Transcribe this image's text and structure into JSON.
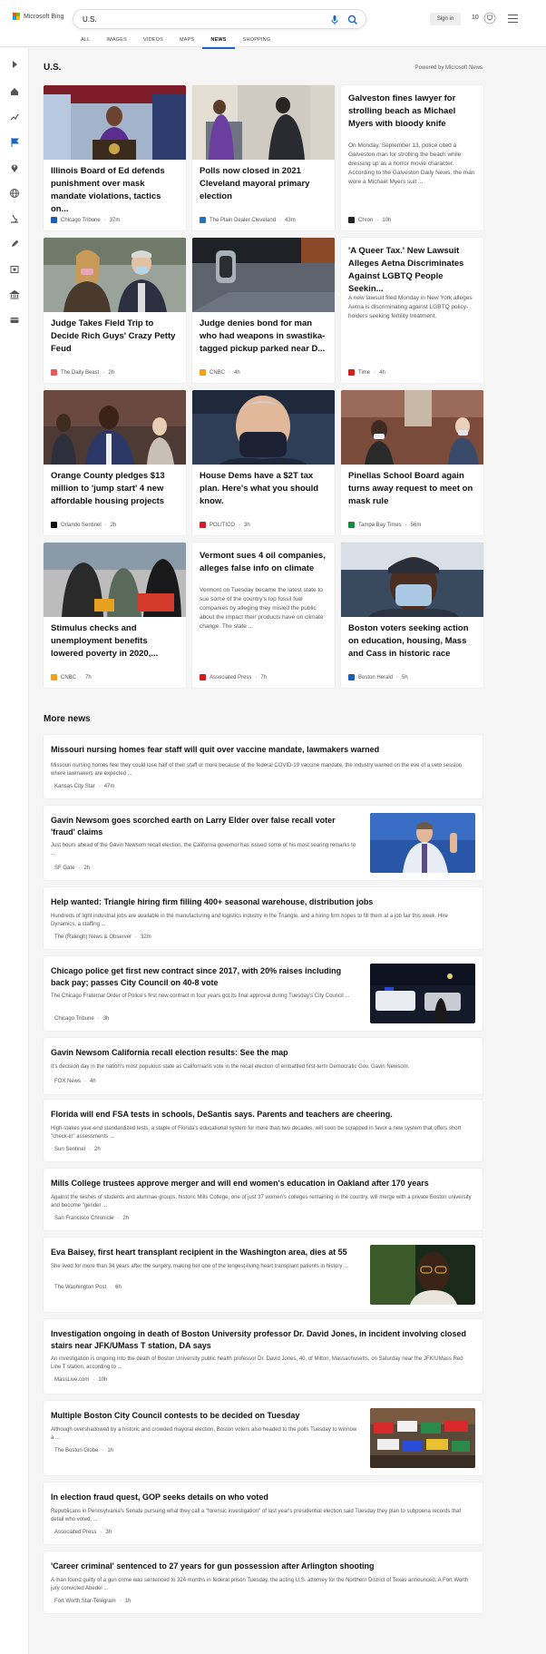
{
  "header": {
    "brand": "Microsoft Bing",
    "search_value": "U.S.",
    "sign_in": "Sign in",
    "points": "10"
  },
  "nav_tabs": [
    {
      "label": "ALL"
    },
    {
      "label": "IMAGES"
    },
    {
      "label": "VIDEOS"
    },
    {
      "label": "MAPS"
    },
    {
      "label": "NEWS"
    },
    {
      "label": "SHOPPING"
    }
  ],
  "section": {
    "title": "U.S.",
    "powered_by": "Powered by Microsoft News"
  },
  "cards": [
    {
      "title": "Illinois Board of Ed defends punishment over mask mandate violations, tactics on...",
      "source": "Chicago Tribune",
      "time": "37m",
      "fav_color": "#1a5fb4"
    },
    {
      "title": "Polls now closed in 2021 Cleveland mayoral primary election",
      "source": "The Plain Dealer Cleveland",
      "time": "43m",
      "fav_color": "#2a6fba"
    },
    {
      "title": "Galveston fines lawyer for strolling beach as Michael Myers with bloody knife",
      "snippet": "On Monday, September 13, police cited a Galveston man for strolling the beach while dressing up as a horror movie character. According to the Galveston Daily News, the man wore a Michael Myers suit ...",
      "source": "Chron",
      "time": "10h",
      "fav_color": "#222222"
    },
    {
      "title": "Judge Takes Field Trip to Decide Rich Guys' Crazy Petty Feud",
      "source": "The Daily Beast",
      "time": "2h",
      "fav_color": "#e85a5a"
    },
    {
      "title": "Judge denies bond for man who had weapons in swastika-tagged pickup parked near D...",
      "source": "CNBC",
      "time": "4h",
      "fav_color": "#f0a020"
    },
    {
      "title": "'A Queer Tax.' New Lawsuit Alleges Aetna Discriminates Against LGBTQ People Seekin...",
      "snippet": "A new lawsuit filed Monday in New York alleges Aetna is discriminating against LGBTQ policy-holders seeking fertility treatment.",
      "source": "Time",
      "time": "4h",
      "fav_color": "#d61f1f"
    },
    {
      "title": "Orange County pledges $13 million to 'jump start' 4 new affordable housing projects",
      "source": "Orlando Sentinel",
      "time": "2h",
      "fav_color": "#111111"
    },
    {
      "title": "House Dems have a $2T tax plan. Here's what you should know.",
      "source": "POLITICO",
      "time": "3h",
      "fav_color": "#d11f2a"
    },
    {
      "title": "Pinellas School Board again turns away request to meet on mask rule",
      "source": "Tampa Bay Times",
      "time": "56m",
      "fav_color": "#1b8a3e"
    },
    {
      "title": "Stimulus checks and unemployment benefits lowered poverty in 2020,...",
      "source": "CNBC",
      "time": "7h",
      "fav_color": "#f0a020"
    },
    {
      "title": "Vermont sues 4 oil companies, alleges false info on climate",
      "snippet": "Vermont on Tuesday became the latest state to sue some of the country's top fossil fuel companies by alleging they misled the public about the impact their products have on climate change. The state ...",
      "source": "Associated Press",
      "time": "7h",
      "fav_color": "#cc1f1f"
    },
    {
      "title": "Boston voters seeking action on education, housing, Mass and Cass in historic race",
      "source": "Boston Herald",
      "time": "5h",
      "fav_color": "#1a5fb4"
    }
  ],
  "more_news": {
    "title": "More news",
    "items": [
      {
        "title": "Missouri nursing homes fear staff will quit over vaccine mandate, lawmakers warned",
        "snippet": "Missouri nursing homes fear they could lose half of their staff or more because of the federal COVID-19 vaccine mandate, the industry warned on the eve of a veto session where lawmakers are expected ...",
        "source": "Kansas City Star",
        "time": "47m",
        "fav_color": "#1a5fb4"
      },
      {
        "title": "Gavin Newsom goes scorched earth on Larry Elder over false recall voter 'fraud' claims",
        "snippet": "Just hours ahead of the Gavin Newsom recall election, the California governor has issued some of his most searing remarks to ...",
        "source": "SF Gate",
        "time": "2h",
        "fav_color": "#e0304a"
      },
      {
        "title": "Help wanted: Triangle hiring firm filling 400+ seasonal warehouse, distribution jobs",
        "snippet": "Hundreds of light industrial jobs are available in the manufacturing and logistics industry in the Triangle, and a hiring firm hopes to fill them at a job fair this week. Hire Dynamics, a staffing ...",
        "source": "The (Raleigh) News & Observer",
        "time": "32m",
        "fav_color": "#c0282d"
      },
      {
        "title": "Chicago police get first new contract since 2017, with 20% raises including back pay; passes City Council on 40-8 vote",
        "snippet": "The Chicago Fraternal Order of Police's first new contract in four years got its final approval during Tuesday's City Council ...",
        "source": "Chicago Tribune",
        "time": "3h",
        "fav_color": "#1a5fb4"
      },
      {
        "title": "Gavin Newsom California recall election results: See the map",
        "snippet": "It's decision day in the nation's most populous state as Californians vote in the recall election of embattled first-term Democratic Gov. Gavin Newsom.",
        "source": "FOX News",
        "time": "4h",
        "fav_color": "#1a3a8a"
      },
      {
        "title": "Florida will end FSA tests in schools, DeSantis says. Parents and teachers are cheering.",
        "snippet": "High-stakes year-end standardized tests, a staple of Florida's educational system for more than two decades, will soon be scrapped in favor a new system that offers short \"check-in\" assessments ...",
        "source": "Sun Sentinel",
        "time": "2h",
        "fav_color": "#222222"
      },
      {
        "title": "Mills College trustees approve merger and will end women's education in Oakland after 170 years",
        "snippet": "Against the wishes of students and alumnae groups, historic Mills College, one of just 37 women's colleges remaining in the country, will merge with a private Boston university and become \"gender ...",
        "source": "San Francisco Chronicle",
        "time": "2h",
        "fav_color": "#222222"
      },
      {
        "title": "Eva Baisey, first heart transplant recipient in the Washington area, dies at 55",
        "snippet": "She lived for more than 34 years after the surgery, making her one of the longest-living heart transplant patients in history ...",
        "source": "The Washington Post",
        "time": "6h",
        "fav_color": "#222222",
        "fav_text": "wp"
      },
      {
        "title": "Investigation ongoing in death of Boston University professor Dr. David Jones, in incident involving closed stairs near JFK/UMass T station, DA says",
        "snippet": "An investigation is ongoing into the death of Boston University public health professor Dr. David Jones, 40, of Milton, Massachusetts, on Saturday near the JFK/UMass Red Line T station, according to ...",
        "source": "MassLive.com",
        "time": "10h",
        "fav_color": "#d0202a"
      },
      {
        "title": "Multiple Boston City Council contests to be decided on Tuesday",
        "snippet": "Although overshadowed by a historic and crowded mayoral election, Boston voters also headed to the polls Tuesday to winnow a ...",
        "source": "The Boston Globe",
        "time": "1h",
        "fav_color": "#222222"
      },
      {
        "title": "In election fraud quest, GOP seeks details on who voted",
        "snippet": "Republicans in Pennsylvania's Senate pursuing what they call a \"forensic investigation\" of last year's presidential election said Tuesday they plan to subpoena records that detail who voted, ...",
        "source": "Associated Press",
        "time": "3h",
        "fav_color": "#cc1f1f",
        "fav_text": "AP"
      },
      {
        "title": "'Career criminal' sentenced to 27 years for gun possession after Arlington shooting",
        "snippet": "A man found guilty of a gun crime was sentenced to 324 months in federal prison Tuesday, the acting U.S. attorney for the Northern District of Texas announced. A Fort Worth jury convicted Abedel ...",
        "source": "Fort Worth Star-Telegram",
        "time": "1h",
        "fav_color": "#222222"
      }
    ]
  }
}
